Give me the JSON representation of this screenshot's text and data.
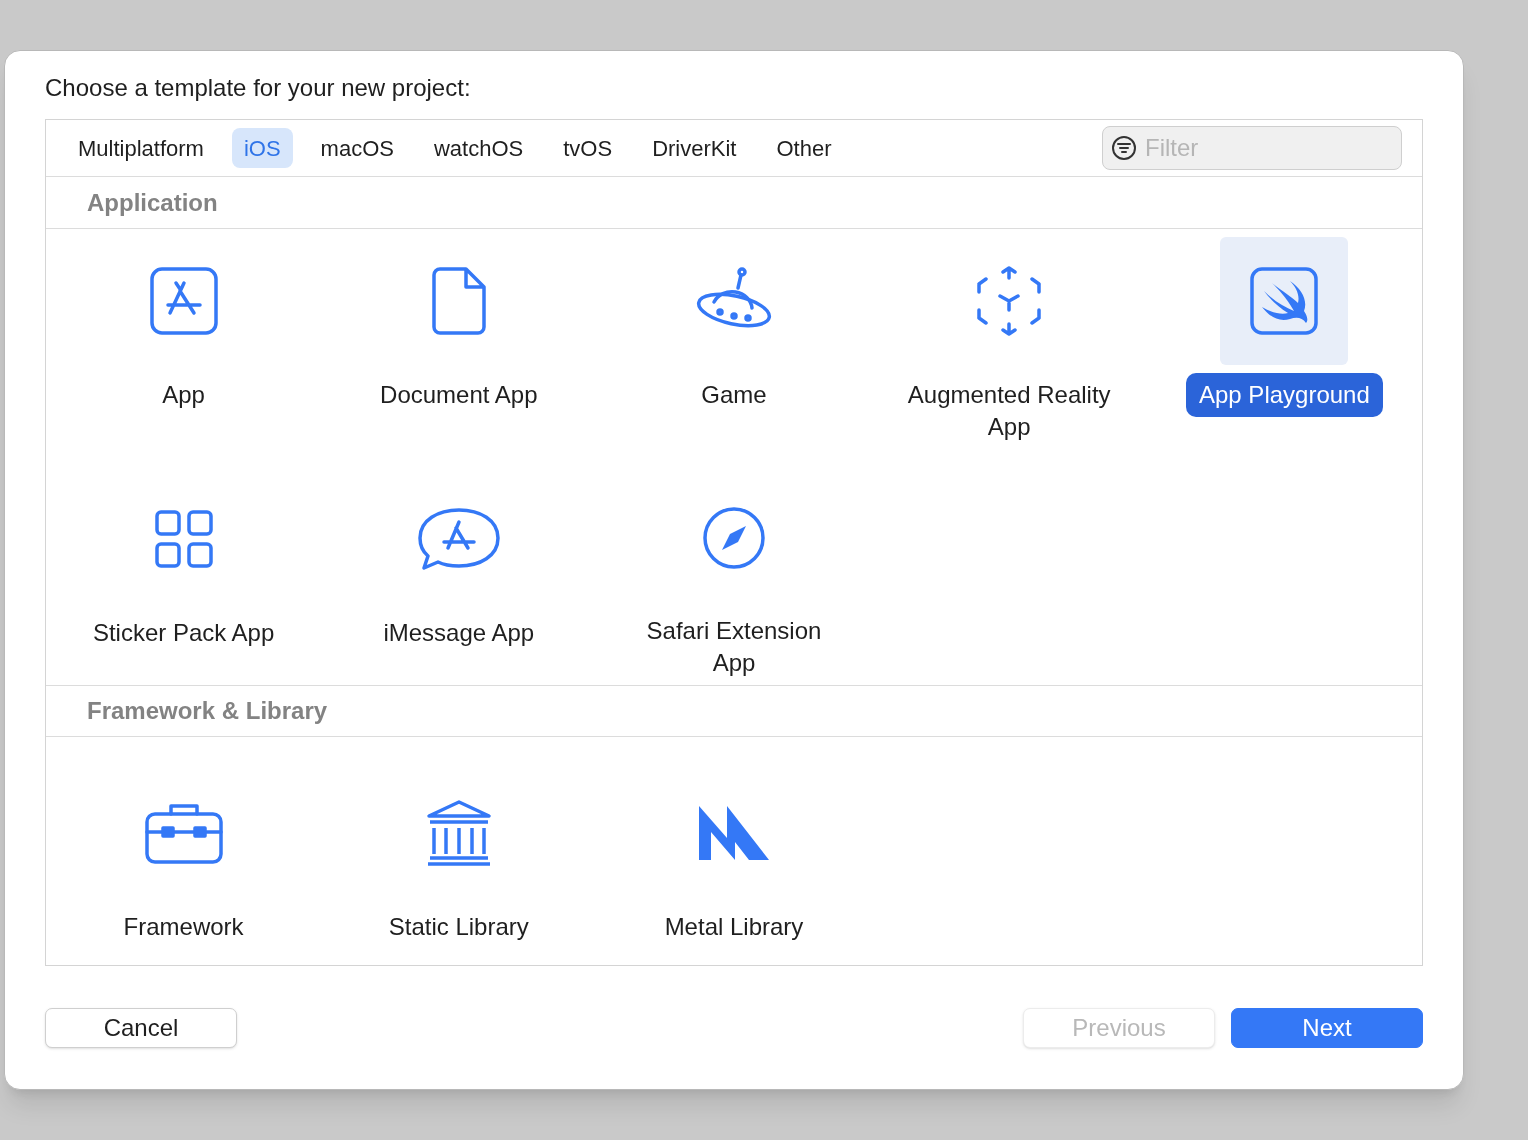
{
  "title": "Choose a template for your new project:",
  "tabs": [
    {
      "label": "Multiplatform",
      "selected": false
    },
    {
      "label": "iOS",
      "selected": true
    },
    {
      "label": "macOS",
      "selected": false
    },
    {
      "label": "watchOS",
      "selected": false
    },
    {
      "label": "tvOS",
      "selected": false
    },
    {
      "label": "DriverKit",
      "selected": false
    },
    {
      "label": "Other",
      "selected": false
    }
  ],
  "filter": {
    "placeholder": "Filter"
  },
  "sections": [
    {
      "title": "Application",
      "items": [
        {
          "label": "App",
          "kind": "appstore",
          "selected": false
        },
        {
          "label": "Document App",
          "kind": "document",
          "selected": false
        },
        {
          "label": "Game",
          "kind": "saucer",
          "selected": false
        },
        {
          "label": "Augmented Reality App",
          "kind": "ar",
          "selected": false
        },
        {
          "label": "App Playground",
          "kind": "swift",
          "selected": true
        },
        {
          "label": "Sticker Pack App",
          "kind": "grid",
          "selected": false
        },
        {
          "label": "iMessage App",
          "kind": "bubble",
          "selected": false
        },
        {
          "label": "Safari Extension App",
          "kind": "compass",
          "selected": false
        }
      ]
    },
    {
      "title": "Framework & Library",
      "items": [
        {
          "label": "Framework",
          "kind": "toolbox",
          "selected": false
        },
        {
          "label": "Static Library",
          "kind": "landmark",
          "selected": false
        },
        {
          "label": "Metal Library",
          "kind": "metal",
          "selected": false
        }
      ]
    }
  ],
  "buttons": [
    {
      "label": "Cancel",
      "kind": "secondary",
      "disabled": false
    },
    {
      "label": "Previous",
      "kind": "secondary",
      "disabled": true
    },
    {
      "label": "Next",
      "kind": "primary",
      "disabled": false
    }
  ]
}
